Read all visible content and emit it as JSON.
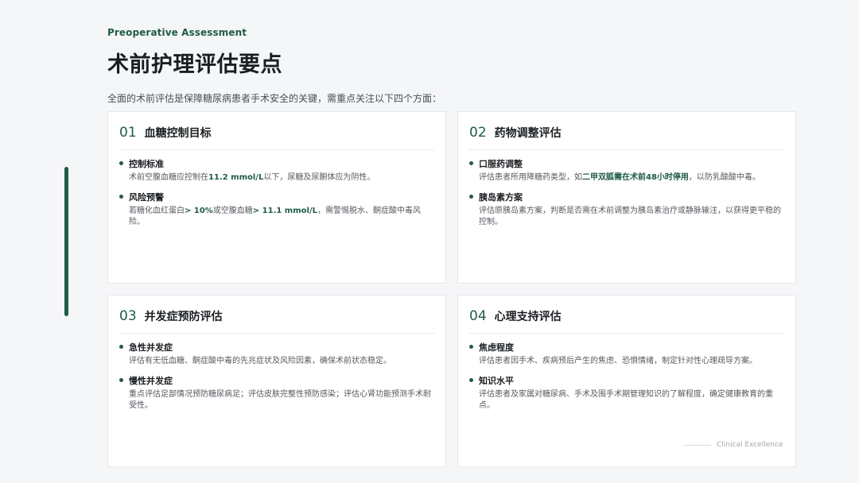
{
  "header": {
    "eyebrow": "Preoperative Assessment",
    "title": "术前护理评估要点",
    "intro": "全面的术前评估是保障糖尿病患者手术安全的关键，需重点关注以下四个方面："
  },
  "cards": [
    {
      "number": "01",
      "title": "血糖控制目标",
      "items": [
        {
          "title": "控制标准",
          "desc_a": "术前空腹血糖应控制在",
          "desc_hl": "11.2 mmol/L",
          "desc_b": "以下，尿糖及尿酮体应为阴性。"
        },
        {
          "title": "风险预警",
          "desc_a": "若糖化血红蛋白",
          "desc_hl": "> 10%",
          "desc_b": "或空腹血糖",
          "desc_hl2": "> 11.1 mmol/L",
          "desc_c": "，需警惕脱水、酮症酸中毒风险。"
        }
      ]
    },
    {
      "number": "02",
      "title": "药物调整评估",
      "items": [
        {
          "title": "口服药调整",
          "desc_a": "评估患者所用降糖药类型，如",
          "desc_hl": "二甲双胍需在术前48小时停用",
          "desc_b": "，以防乳酸酸中毒。"
        },
        {
          "title": "胰岛素方案",
          "desc": "评估原胰岛素方案，判断是否需在术前调整为胰岛素治疗或静脉输注，以获得更平稳的控制。"
        }
      ]
    },
    {
      "number": "03",
      "title": "并发症预防评估",
      "items": [
        {
          "title": "急性并发症",
          "desc": "评估有无低血糖、酮症酸中毒的先兆症状及风险因素，确保术前状态稳定。"
        },
        {
          "title": "慢性并发症",
          "desc": "重点评估足部情况预防糖尿病足；评估皮肤完整性预防感染；评估心肾功能预测手术耐受性。"
        }
      ]
    },
    {
      "number": "04",
      "title": "心理支持评估",
      "items": [
        {
          "title": "焦虑程度",
          "desc": "评估患者因手术、疾病预后产生的焦虑、恐惧情绪，制定针对性心理疏导方案。"
        },
        {
          "title": "知识水平",
          "desc": "评估患者及家属对糖尿病、手术及围手术期管理知识的了解程度，确定健康教育的重点。"
        }
      ]
    }
  ],
  "footer": {
    "note": "Clinical Excellence"
  },
  "colors": {
    "accent": "#1f5c46",
    "background": "#f5f6f8",
    "card": "#ffffff"
  }
}
